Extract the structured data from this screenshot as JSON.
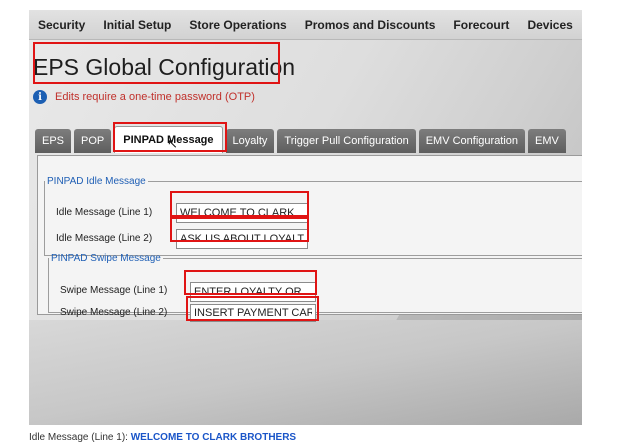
{
  "top_nav": [
    "Security",
    "Initial Setup",
    "Store Operations",
    "Promos and Discounts",
    "Forecourt",
    "Devices"
  ],
  "page_title": "EPS Global Configuration",
  "notice": "Edits require a one-time password (OTP)",
  "tabs": [
    "EPS",
    "POP",
    "PINPAD Message",
    "Loyalty",
    "Trigger Pull Configuration",
    "EMV Configuration",
    "EMV"
  ],
  "idle_section": {
    "legend": "PINPAD Idle Message",
    "line1_label": "Idle Message (Line 1)",
    "line1_value": "WELCOME TO CLARK",
    "line2_label": "Idle Message (Line 2)",
    "line2_value": "ASK US ABOUT LOYALT"
  },
  "swipe_section": {
    "legend": "PINPAD Swipe Message",
    "line1_label": "Swipe Message (Line 1)",
    "line1_value": "ENTER LOYALTY OR",
    "line2_label": "Swipe Message (Line 2)",
    "line2_value": "INSERT PAYMENT CARI"
  },
  "caption": {
    "prefix": "Idle Message (Line 1):",
    "value": "WELCOME TO CLARK BROTHERS"
  },
  "colors": {
    "highlight": "#e01414",
    "legend": "#1f5fb5",
    "notice": "#c0302b",
    "info_icon": "#1c5fb3"
  }
}
